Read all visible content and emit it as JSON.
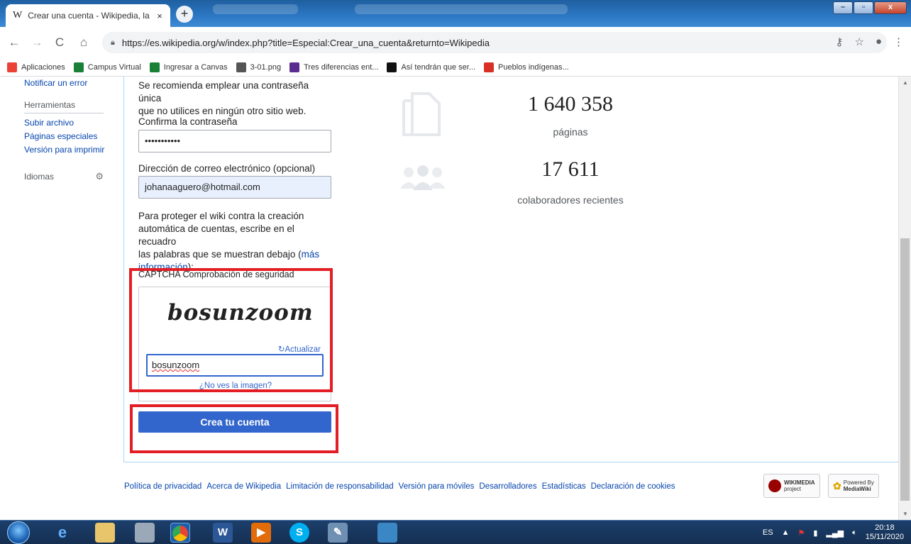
{
  "browser": {
    "tab_logo": "W",
    "tab_title": "Crear una cuenta - Wikipedia, la",
    "tab_close": "×",
    "new_tab": "+",
    "url": "https://es.wikipedia.org/w/index.php?title=Especial:Crear_una_cuenta&returnto=Wikipedia",
    "window_buttons": {
      "minimize": "–",
      "maximize": "▫",
      "close": "x"
    }
  },
  "bookmarks": [
    {
      "label": "Aplicaciones",
      "icon": "apps-grid-icon",
      "color": "#ea4335"
    },
    {
      "label": "Campus Virtual",
      "icon": "campus-icon",
      "color": "#1a7f37"
    },
    {
      "label": "Ingresar a Canvas",
      "icon": "canvas-icon",
      "color": "#1a7f37"
    },
    {
      "label": "3-01.png",
      "icon": "globe-icon",
      "color": "#555555"
    },
    {
      "label": "Tres diferencias ent...",
      "icon": "m-logo-icon",
      "color": "#5b2d90"
    },
    {
      "label": "Así tendrán que ser...",
      "icon": "page-icon",
      "color": "#111111"
    },
    {
      "label": "Pueblos indígenas...",
      "icon": "bookmark-red-icon",
      "color": "#d93025"
    }
  ],
  "sidebar": {
    "report_link": "Notificar un error",
    "tools_heading": "Herramientas",
    "tools": [
      "Subir archivo",
      "Páginas especiales",
      "Versión para imprimir"
    ],
    "languages_heading": "Idiomas"
  },
  "form": {
    "password_help_1": "Se recomienda emplear una contraseña única",
    "password_help_2": "que no utilices en ningún otro sitio web.",
    "confirm_label": "Confirma la contraseña",
    "confirm_value": "•••••••••••",
    "email_label": "Dirección de correo electrónico (opcional)",
    "email_value": "johanaaguero@hotmail.com",
    "captcha_intro_1": "Para proteger el wiki contra la creación",
    "captcha_intro_2": "automática de cuentas, escribe en el recuadro",
    "captcha_intro_3": "las palabras que se muestran debajo (",
    "captcha_more_link_1": "más",
    "captcha_more_link_2": "información",
    "captcha_intro_end": "):",
    "captcha_label": "CAPTCHA Comprobación de seguridad",
    "captcha_text": "bosunzoom",
    "refresh_label": "Actualizar",
    "captcha_input_value": "bosunzoom",
    "no_image_link": "¿No ves la imagen?",
    "submit_label": "Crea tu cuenta"
  },
  "stats": {
    "pages_number": "1 640 358",
    "pages_label": "páginas",
    "contributors_number": "17 611",
    "contributors_label": "colaboradores recientes"
  },
  "footer": {
    "links": [
      "Política de privacidad",
      "Acerca de Wikipedia",
      "Limitación de responsabilidad",
      "Versión para móviles",
      "Desarrolladores",
      "Estadísticas",
      "Declaración de cookies"
    ],
    "wikimedia_badge": "WIKIMEDIA",
    "wikimedia_sub": "project",
    "mediawiki_badge": "MediaWiki",
    "mediawiki_sub": "Powered By"
  },
  "taskbar": {
    "language": "ES",
    "time": "20:18",
    "date": "15/11/2020"
  },
  "colors": {
    "highlight": "#e31e24",
    "submit": "#3366cc",
    "link": "#0645ad"
  }
}
